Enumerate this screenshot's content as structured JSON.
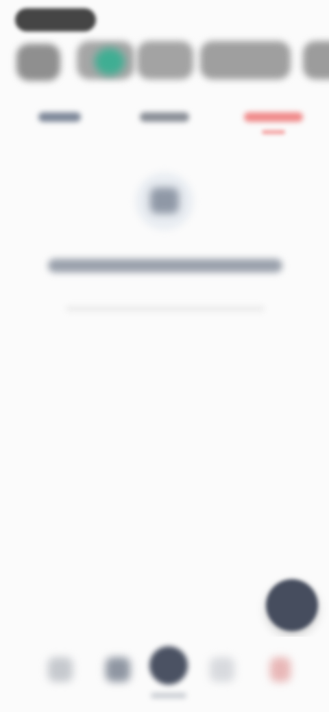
{
  "status_bar": {
    "pill": ""
  },
  "filters": {
    "chips": [
      {
        "label": ""
      },
      {
        "label": ""
      },
      {
        "label": ""
      },
      {
        "label": ""
      },
      {
        "label": ""
      }
    ],
    "accent_color": "#3fae93"
  },
  "tabs": {
    "items": [
      {
        "label": ""
      },
      {
        "label": ""
      },
      {
        "label": ""
      }
    ],
    "active_index": 2,
    "active_color": "#f08a8a"
  },
  "empty_state": {
    "icon": "empty-box-icon",
    "message": "",
    "submessage": ""
  },
  "fab": {
    "icon": "plus-icon",
    "color": "#464d5e"
  },
  "bottom_nav": {
    "items": [
      {
        "icon": "home-icon",
        "label": ""
      },
      {
        "icon": "chart-icon",
        "label": ""
      },
      {
        "icon": "add-icon",
        "label": ""
      },
      {
        "icon": "settings-icon",
        "label": ""
      },
      {
        "icon": "heart-icon",
        "label": ""
      }
    ]
  }
}
